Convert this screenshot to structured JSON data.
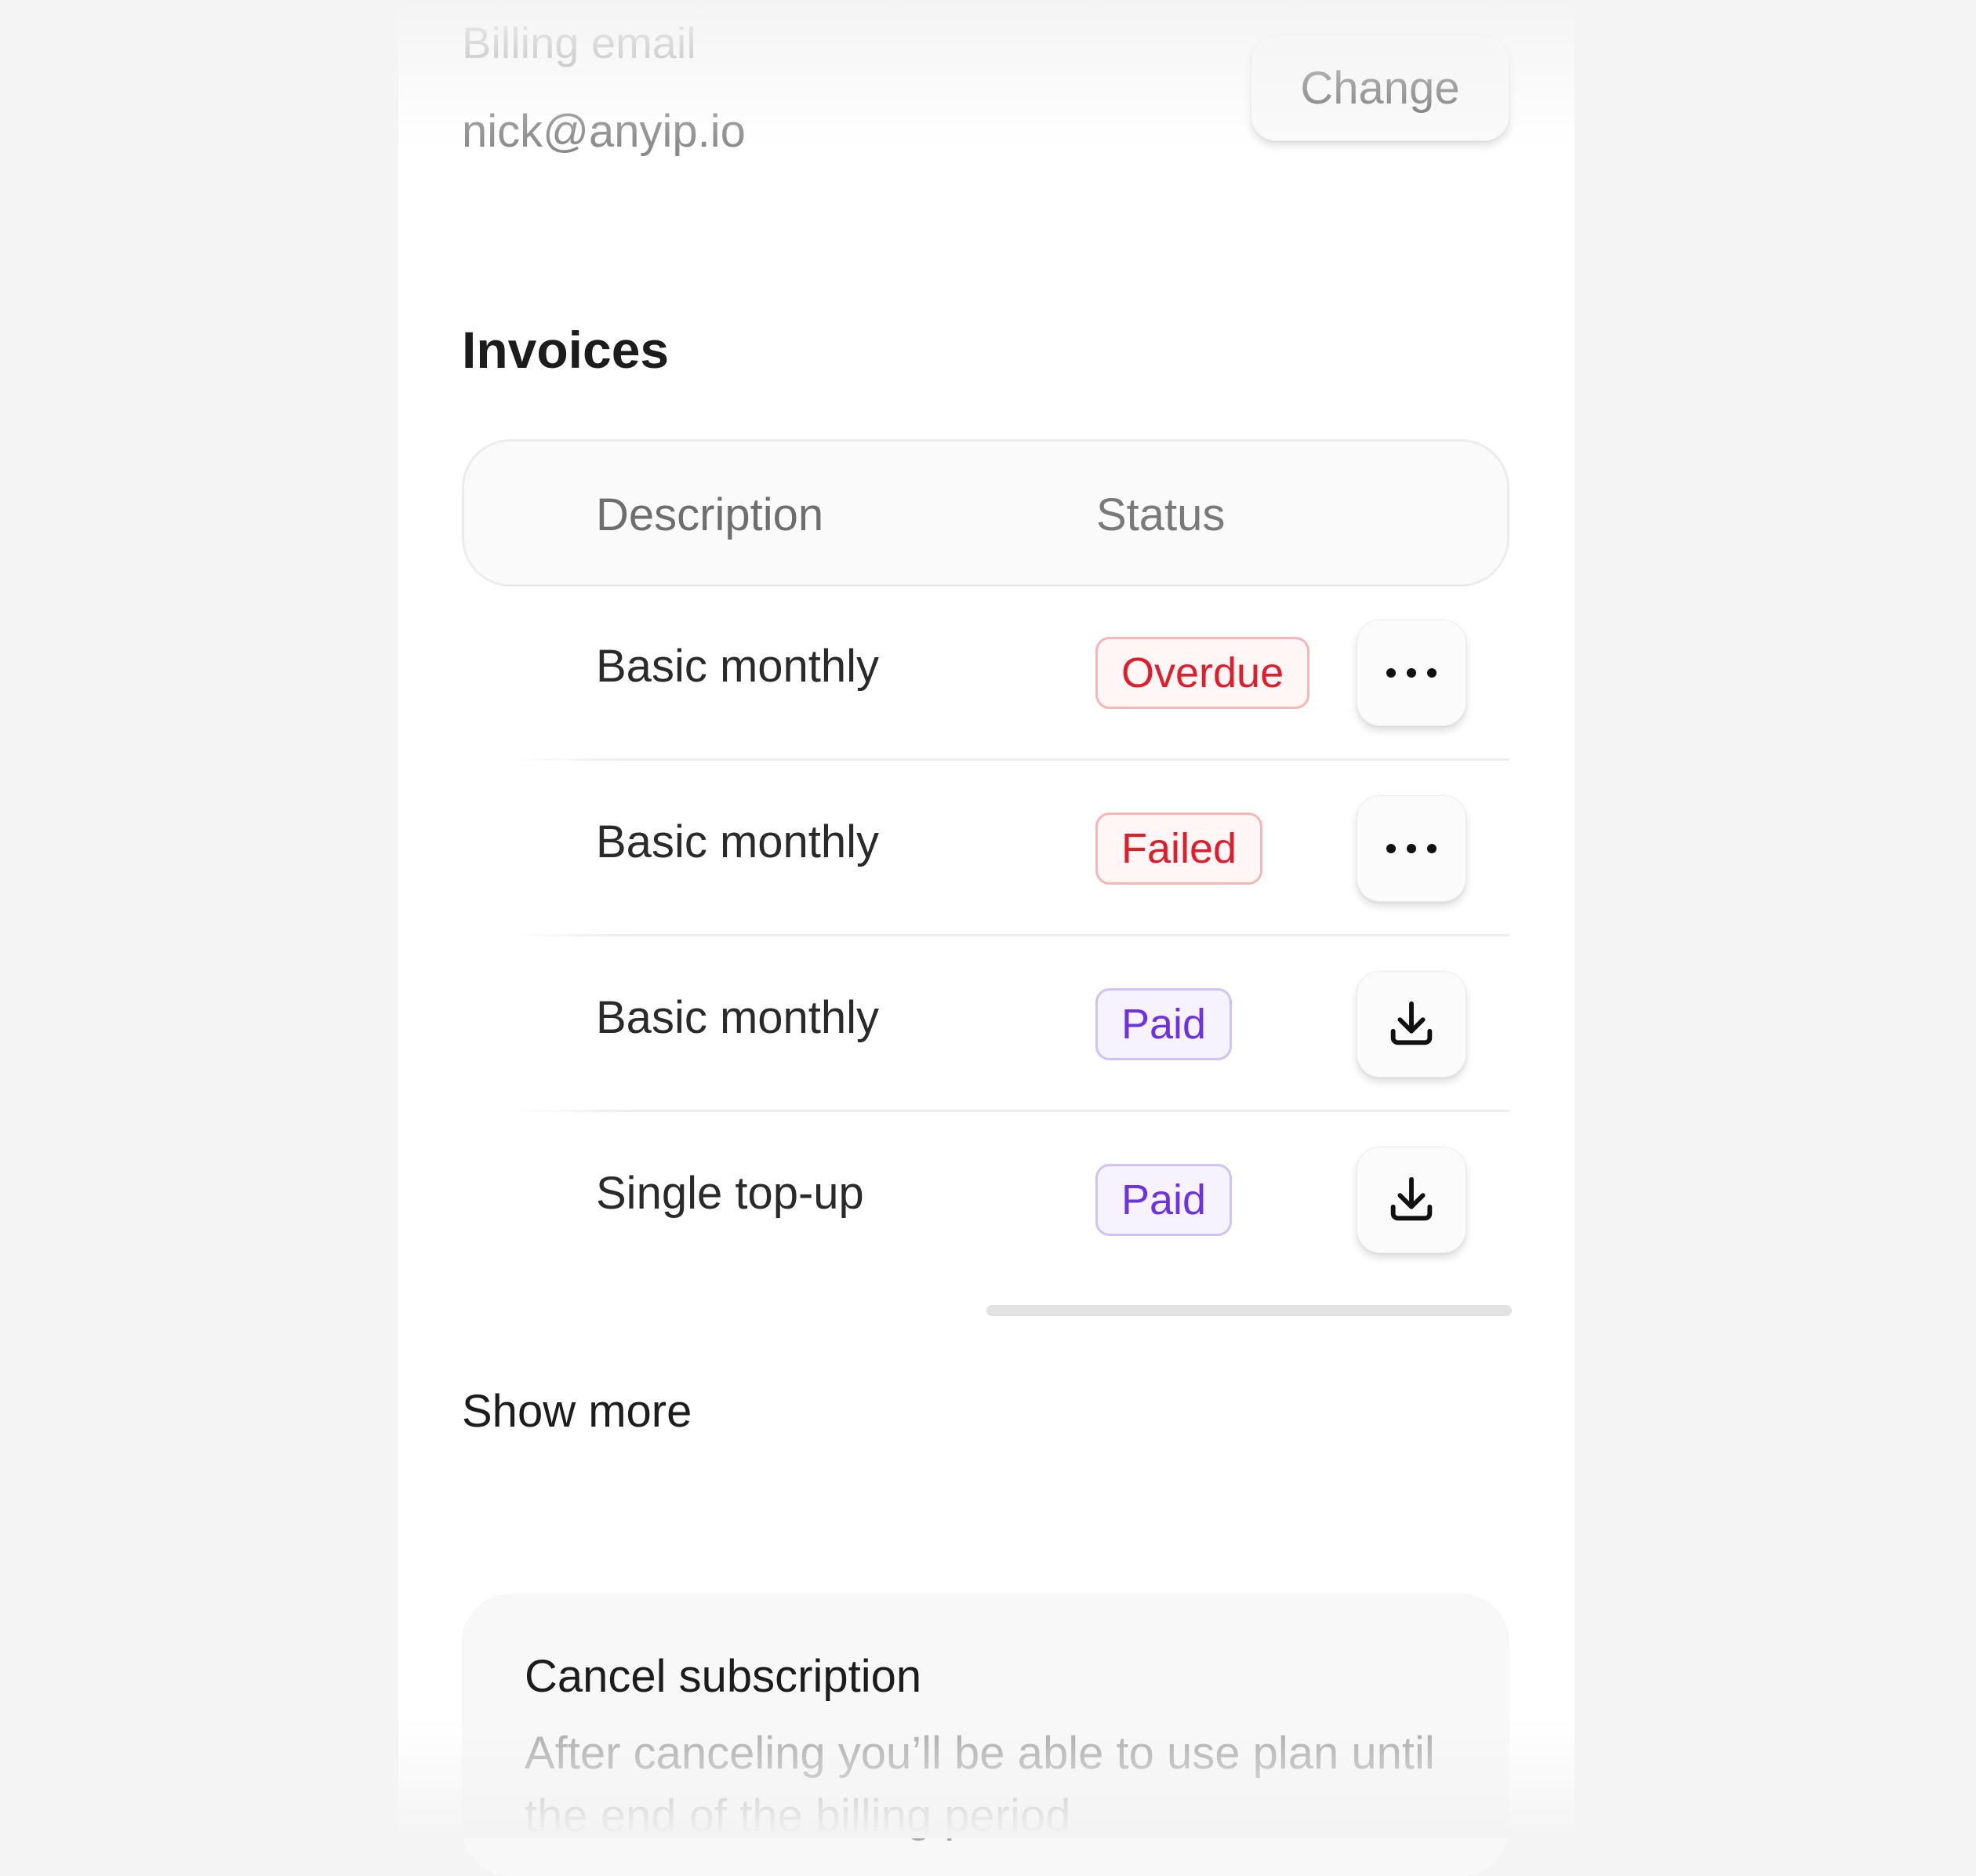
{
  "billing": {
    "email_label": "Billing email",
    "email_value": "nick@anyip.io",
    "change_label": "Change"
  },
  "invoices": {
    "title": "Invoices",
    "columns": {
      "description": "Description",
      "status": "Status"
    },
    "rows": [
      {
        "description": "Basic monthly",
        "status": "Overdue",
        "status_color": "#e01d2b",
        "action_icon": "more-horizontal-icon"
      },
      {
        "description": "Basic monthly",
        "status": "Failed",
        "status_color": "#e01d2b",
        "action_icon": "more-horizontal-icon"
      },
      {
        "description": "Basic monthly",
        "status": "Paid",
        "status_color": "#6d33e0",
        "action_icon": "download-icon"
      },
      {
        "description": "Single top-up",
        "status": "Paid",
        "status_color": "#6d33e0",
        "action_icon": "download-icon"
      }
    ],
    "show_more": "Show more"
  },
  "cancel": {
    "title": "Cancel subscription",
    "description": "After canceling you’ll be able to use plan until the end of the billing period"
  }
}
